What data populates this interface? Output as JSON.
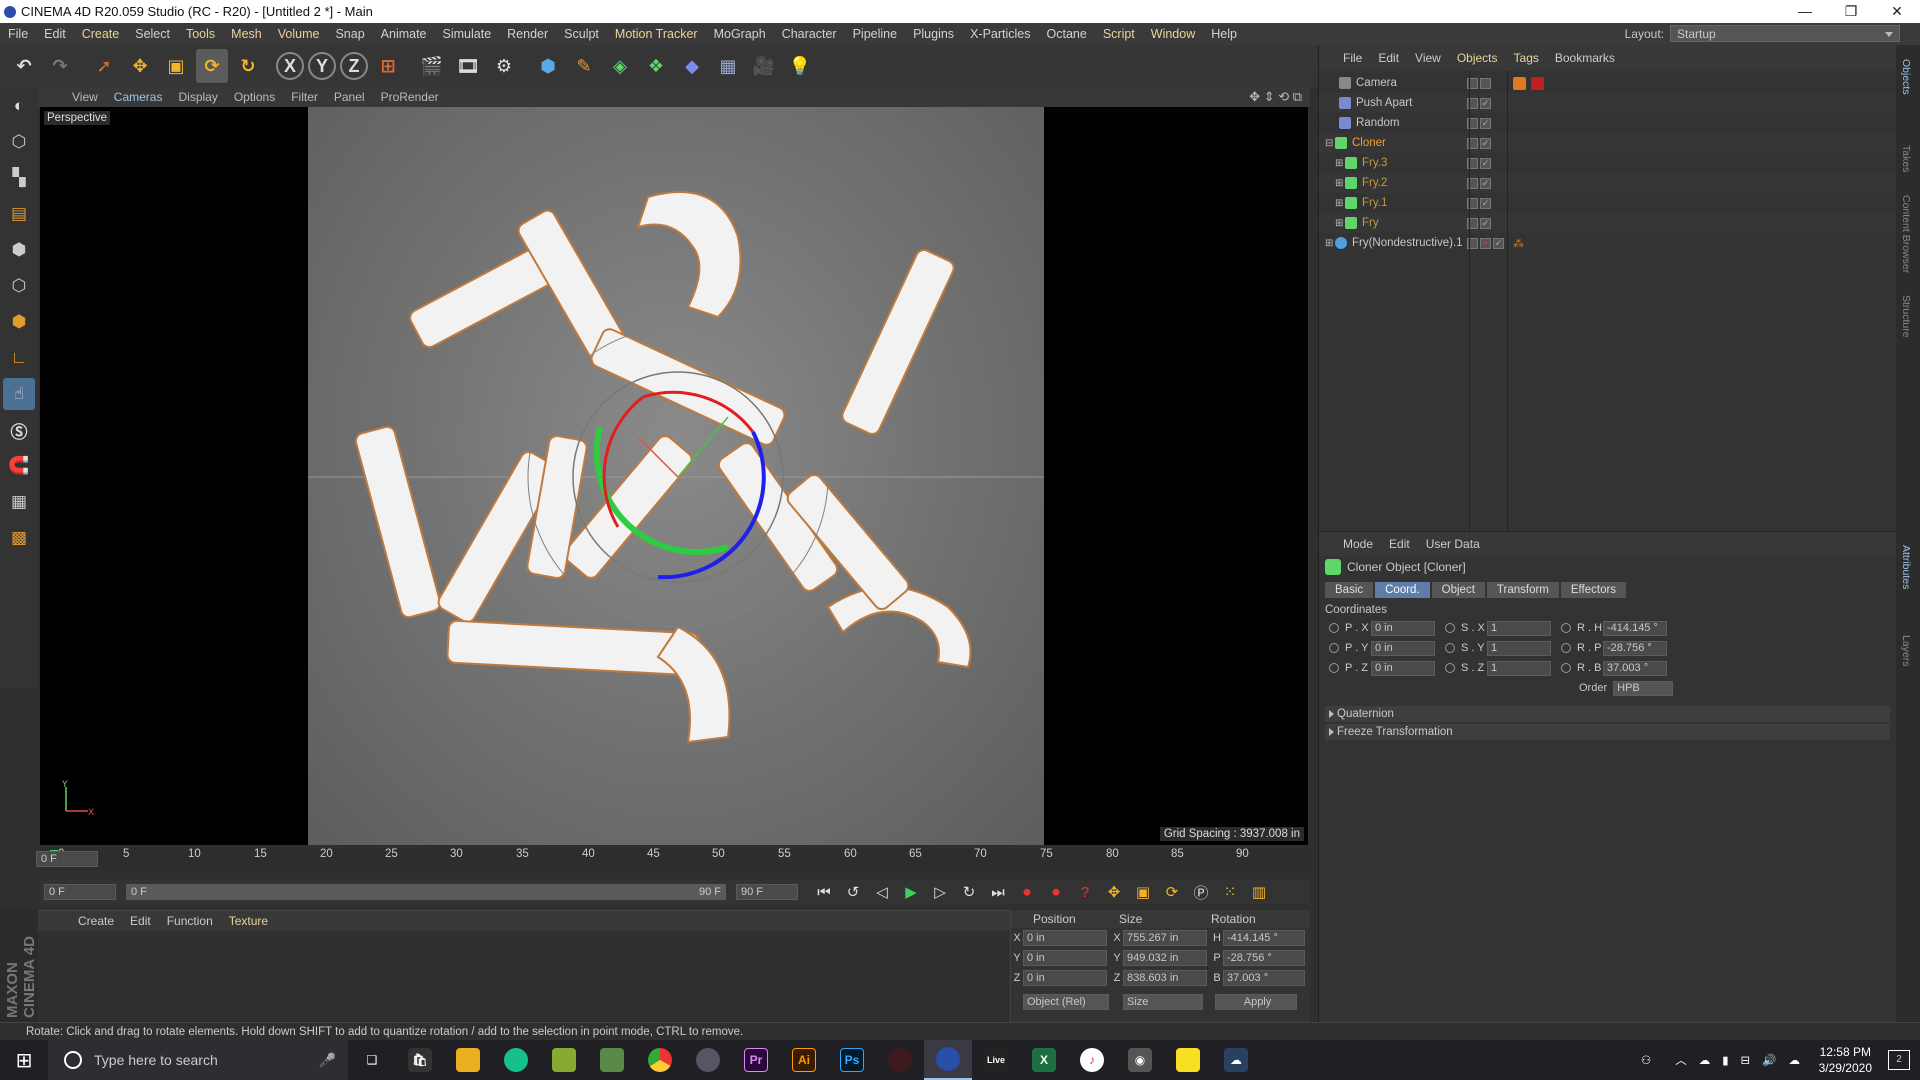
{
  "window": {
    "title": "CINEMA 4D R20.059 Studio (RC - R20) - [Untitled 2 *] - Main"
  },
  "menu": [
    "File",
    "Edit",
    "Create",
    "Select",
    "Tools",
    "Mesh",
    "Volume",
    "Snap",
    "Animate",
    "Simulate",
    "Render",
    "Sculpt",
    "Motion Tracker",
    "MoGraph",
    "Character",
    "Pipeline",
    "Plugins",
    "X-Particles",
    "Octane",
    "Script",
    "Window",
    "Help"
  ],
  "layout": {
    "label": "Layout:",
    "value": "Startup"
  },
  "viewport": {
    "menu": [
      "View",
      "Cameras",
      "Display",
      "Options",
      "Filter",
      "Panel",
      "ProRender"
    ],
    "label": "Perspective",
    "grid_spacing": "Grid Spacing : 3937.008 in"
  },
  "timeline": {
    "ticks": [
      "0",
      "5",
      "10",
      "15",
      "20",
      "25",
      "30",
      "35",
      "40",
      "45",
      "50",
      "55",
      "60",
      "65",
      "70",
      "75",
      "80",
      "85",
      "90"
    ],
    "current_frame_right": "0 F",
    "start": "0 F",
    "range_start": "0 F",
    "range_end": "90 F",
    "end": "90 F"
  },
  "materials": {
    "menu": [
      "Create",
      "Edit",
      "Function",
      "Texture"
    ]
  },
  "maxon": "MAXON CINEMA 4D",
  "coords": {
    "headers": [
      "Position",
      "Size",
      "Rotation"
    ],
    "rows": [
      {
        "axis": "X",
        "pos": "0 in",
        "size_axis": "X",
        "size": "755.267 in",
        "rot_axis": "H",
        "rot": "-414.145 °"
      },
      {
        "axis": "Y",
        "pos": "0 in",
        "size_axis": "Y",
        "size": "949.032 in",
        "rot_axis": "P",
        "rot": "-28.756 °"
      },
      {
        "axis": "Z",
        "pos": "0 in",
        "size_axis": "Z",
        "size": "838.603 in",
        "rot_axis": "B",
        "rot": "37.003 °"
      }
    ],
    "mode": "Object (Rel)",
    "size_mode": "Size",
    "apply": "Apply"
  },
  "status": "Rotate: Click and drag to rotate elements. Hold down SHIFT to add to quantize rotation / add to the selection in point mode, CTRL to remove.",
  "objects": {
    "menu": [
      "File",
      "Edit",
      "View",
      "Objects",
      "Tags",
      "Bookmarks"
    ],
    "items": [
      {
        "name": "Camera",
        "indent": 0,
        "color": "#c8c8c8"
      },
      {
        "name": "Push Apart",
        "indent": 0,
        "color": "#c8c8c8"
      },
      {
        "name": "Random",
        "indent": 0,
        "color": "#c8c8c8"
      },
      {
        "name": "Cloner",
        "indent": 0,
        "color": "#f0a030"
      },
      {
        "name": "Fry.3",
        "indent": 1,
        "color": "#c89a3a"
      },
      {
        "name": "Fry.2",
        "indent": 1,
        "color": "#c89a3a"
      },
      {
        "name": "Fry.1",
        "indent": 1,
        "color": "#c89a3a"
      },
      {
        "name": "Fry",
        "indent": 1,
        "color": "#c89a3a"
      },
      {
        "name": "Fry(Nondestructive).1",
        "indent": 0,
        "color": "#c8c8c8"
      }
    ]
  },
  "attributes": {
    "menu": [
      "Mode",
      "Edit",
      "User Data"
    ],
    "title": "Cloner Object [Cloner]",
    "tabs": [
      "Basic",
      "Coord.",
      "Object",
      "Transform",
      "Effectors"
    ],
    "section": "Coordinates",
    "rows": [
      {
        "p_label": "P . X",
        "p": "0 in",
        "s_label": "S . X",
        "s": "1",
        "r_label": "R . H",
        "r": "-414.145 °"
      },
      {
        "p_label": "P . Y",
        "p": "0 in",
        "s_label": "S . Y",
        "s": "1",
        "r_label": "R . P",
        "r": "-28.756 °"
      },
      {
        "p_label": "P . Z",
        "p": "0 in",
        "s_label": "S . Z",
        "s": "1",
        "r_label": "R . B",
        "r": "37.003 °"
      }
    ],
    "order_label": "Order",
    "order": "HPB",
    "collapsed": [
      "Quaternion",
      "Freeze Transformation"
    ]
  },
  "side_tabs": [
    "Objects",
    "Takes",
    "Content Browser",
    "Structure",
    "Attributes",
    "Layers"
  ],
  "taskbar": {
    "search_placeholder": "Type here to search",
    "apps": [
      "Pr",
      "Ai",
      "Ps",
      "Live"
    ],
    "time": "12:58 PM",
    "date": "3/29/2020",
    "notifications": "2"
  },
  "colors": {
    "accent": "#5d7ea8",
    "highlight": "#e8d49a"
  }
}
